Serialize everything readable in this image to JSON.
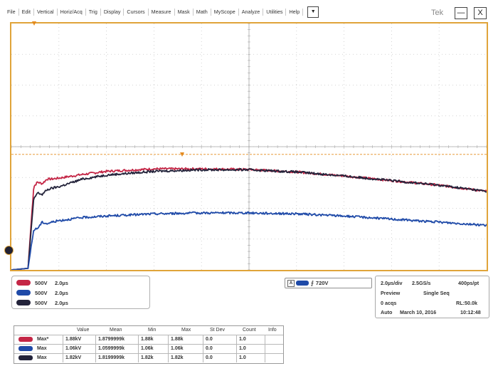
{
  "menu": {
    "items": [
      "File",
      "Edit",
      "Vertical",
      "Horiz/Acq",
      "Trig",
      "Display",
      "Cursors",
      "Measure",
      "Mask",
      "Math",
      "MyScope",
      "Analyze",
      "Utilities",
      "Help"
    ],
    "dropdown_glyph": "▼"
  },
  "brand": "Tek",
  "window": {
    "minimize_glyph": "—",
    "close_glyph": "X"
  },
  "colors": {
    "ch1": "#c42646",
    "ch2": "#1f4aa8",
    "ch3": "#23233a",
    "graticule_frame": "#e0a43a",
    "marker": "#e48a1e",
    "grid": "#c8c8c8"
  },
  "channels": [
    {
      "id": "ch1",
      "scale": "500V",
      "timebase": "2.0µs"
    },
    {
      "id": "ch2",
      "scale": "500V",
      "timebase": "2.0µs"
    },
    {
      "id": "ch3",
      "scale": "500V",
      "timebase": "2.0µs"
    }
  ],
  "trigger": {
    "source_letter": "A",
    "slope_glyph": "⨍",
    "level": "720V"
  },
  "acquisition": {
    "horizontal_scale": "2.0µs/div",
    "sample_rate": "2.5GS/s",
    "resolution": "400ps/pt",
    "mode": "Preview",
    "sequence": "Single Seq",
    "acqs": "0 acqs",
    "record_length": "RL:50.0k",
    "trigger_mode": "Auto",
    "date": "March 10, 2016",
    "time": "10:12:48"
  },
  "measurements": {
    "headers": [
      "Value",
      "Mean",
      "Min",
      "Max",
      "St Dev",
      "Count",
      "Info"
    ],
    "rows": [
      {
        "label": "Max*",
        "value": "1.88kV",
        "mean": "1.8799999k",
        "min": "1.88k",
        "max": "1.88k",
        "stdev": "0.0",
        "count": "1.0"
      },
      {
        "label": "Max",
        "value": "1.06kV",
        "mean": "1.0599999k",
        "min": "1.06k",
        "max": "1.06k",
        "stdev": "0.0",
        "count": "1.0"
      },
      {
        "label": "Max",
        "value": "1.82kV",
        "mean": "1.8199999k",
        "min": "1.82k",
        "max": "1.82k",
        "stdev": "0.0",
        "count": "1.0"
      }
    ]
  },
  "chart_data": {
    "type": "line",
    "grid": true,
    "divisions": {
      "x": 10,
      "y": 8
    },
    "x_units": "div",
    "y_units": "div",
    "series": [
      {
        "id": "ch1",
        "x": [
          0,
          0.35,
          0.47,
          0.55,
          0.65,
          0.75,
          0.85,
          1.0,
          1.5,
          2.0,
          3.0,
          4.0,
          5.0,
          6.0,
          7.0,
          8.0,
          9.0,
          10.0
        ],
        "y": [
          0.0,
          0.05,
          2.7,
          2.85,
          2.8,
          2.95,
          2.95,
          2.98,
          3.1,
          3.2,
          3.28,
          3.28,
          3.26,
          3.18,
          3.05,
          2.9,
          2.75,
          2.55
        ]
      },
      {
        "id": "ch3",
        "x": [
          0,
          0.35,
          0.47,
          0.55,
          0.65,
          0.75,
          0.85,
          1.0,
          1.5,
          2.0,
          3.0,
          4.0,
          5.0,
          6.0,
          7.0,
          8.0,
          9.0,
          10.0
        ],
        "y": [
          0.0,
          0.05,
          2.3,
          2.5,
          2.45,
          2.6,
          2.65,
          2.7,
          2.95,
          3.08,
          3.2,
          3.25,
          3.25,
          3.18,
          3.05,
          2.9,
          2.75,
          2.55
        ]
      },
      {
        "id": "ch2",
        "x": [
          0,
          0.35,
          0.47,
          0.55,
          0.65,
          0.75,
          0.85,
          1.0,
          1.5,
          2.0,
          3.0,
          4.0,
          5.0,
          6.0,
          7.0,
          8.0,
          9.0,
          10.0
        ],
        "y": [
          0.0,
          0.05,
          1.3,
          1.35,
          1.55,
          1.5,
          1.55,
          1.6,
          1.7,
          1.75,
          1.82,
          1.85,
          1.85,
          1.82,
          1.75,
          1.65,
          1.55,
          1.45
        ]
      }
    ],
    "trigger_level_div": 3.75,
    "ground_marker_div": 0.0
  }
}
